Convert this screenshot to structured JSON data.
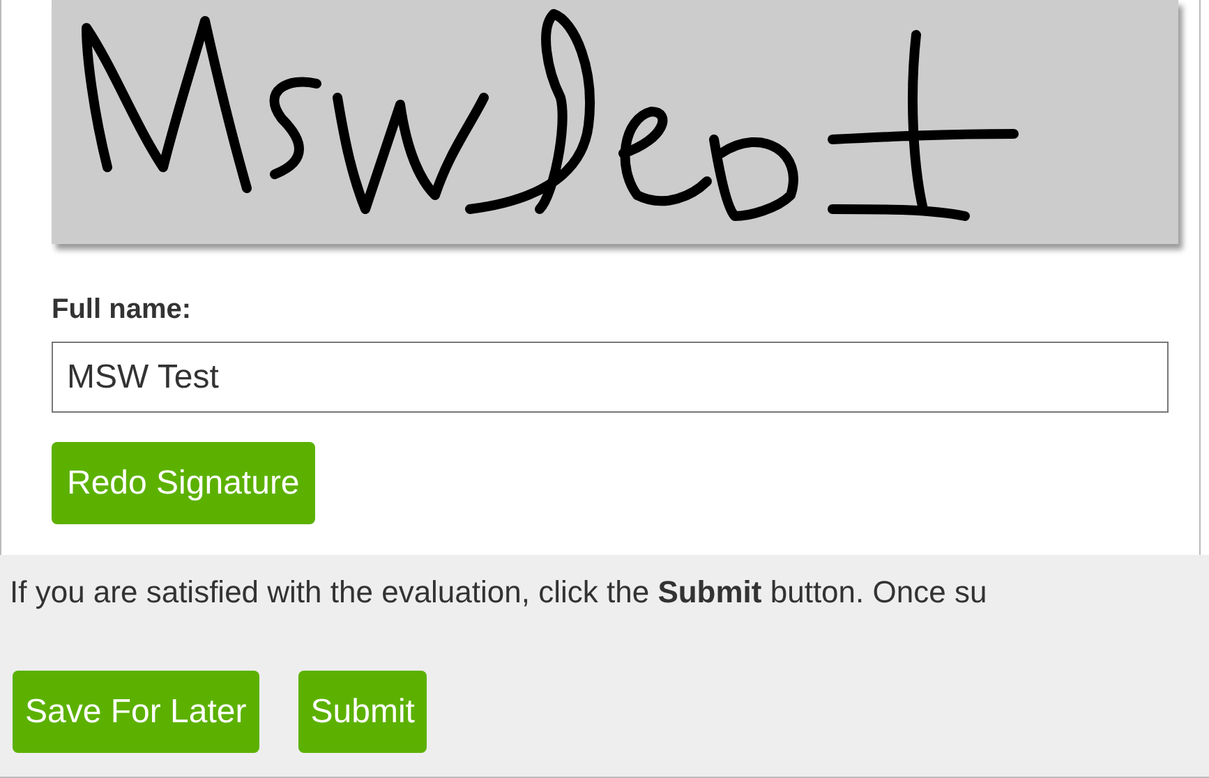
{
  "full_name": {
    "label": "Full name:",
    "value": "MSW Test"
  },
  "redo_button": "Redo Signature",
  "footer": {
    "message": "If you are satisfied with the evaluation, click the **Submit** button. Once su",
    "buttons": [
      "Save For Later",
      "Submit"
    ]
  }
}
